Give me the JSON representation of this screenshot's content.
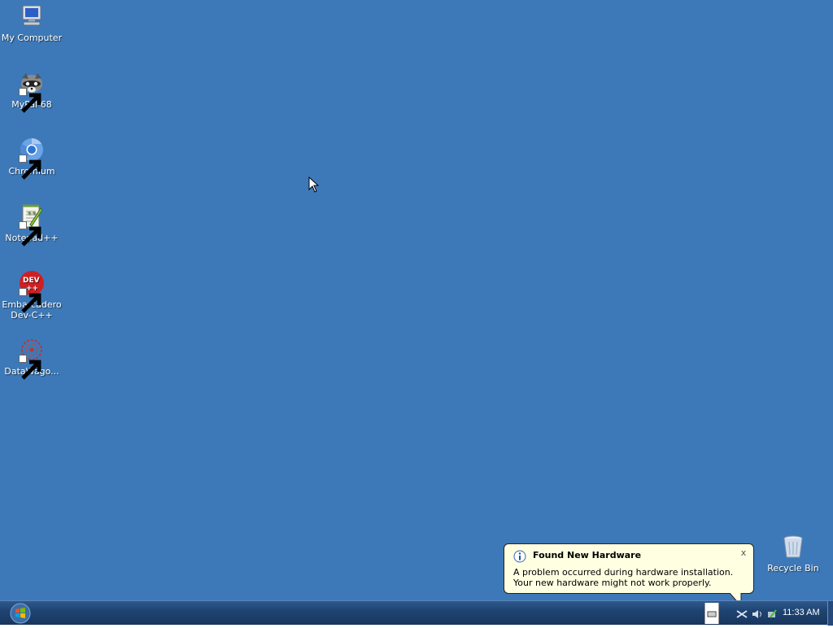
{
  "desktop": {
    "background": "#3d79b8",
    "icons": [
      {
        "label": "My Computer",
        "icon": "computer-icon",
        "shortcut": false
      },
      {
        "label": "MyPal 68",
        "icon": "mypal-raccoon-icon",
        "shortcut": true
      },
      {
        "label": "Chromium",
        "icon": "chromium-icon",
        "shortcut": true
      },
      {
        "label": "Notepad++",
        "icon": "notepadpp-icon",
        "shortcut": true
      },
      {
        "label": "Embarcadero\nDev-C++",
        "icon": "devcpp-icon",
        "shortcut": true
      },
      {
        "label": "DataWago...",
        "icon": "datawagon-icon",
        "shortcut": true
      },
      {
        "label": "Recycle Bin",
        "icon": "recycle-bin-icon",
        "shortcut": false
      }
    ]
  },
  "notification": {
    "icon": "info-icon",
    "title": "Found New Hardware",
    "body": "A problem occurred during hardware installation. Your new hardware might not work properly.",
    "close_label": "x"
  },
  "taskbar": {
    "start_icon": "windows-orb-icon",
    "tray_icons": [
      "keyboard-icon",
      "network-icon",
      "volume-icon",
      "safely-remove-icon"
    ],
    "clock": "11:33 AM"
  }
}
